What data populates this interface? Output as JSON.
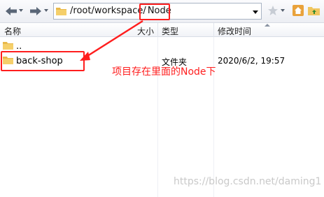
{
  "toolbar": {
    "back_icon": "back-arrow-icon",
    "forward_icon": "forward-arrow-icon",
    "address": {
      "path_prefix": "/root/workspace/",
      "path_highlight": "Node"
    },
    "right_icons": [
      "star-icon",
      "home-icon",
      "folder-up-icon"
    ]
  },
  "columns": {
    "name": "名称",
    "size": "大小",
    "type": "类型",
    "modified": "修改时间"
  },
  "rows": [
    {
      "name": "..",
      "type": "",
      "modified": ""
    },
    {
      "name": "back-shop",
      "type": "文件夹",
      "modified": "2020/6/2, 19:57"
    }
  ],
  "annotation": {
    "note": "项目存在里面的Node下",
    "color": "#ff1e1e"
  },
  "watermark": "https://blog.csdn.net/daming1"
}
